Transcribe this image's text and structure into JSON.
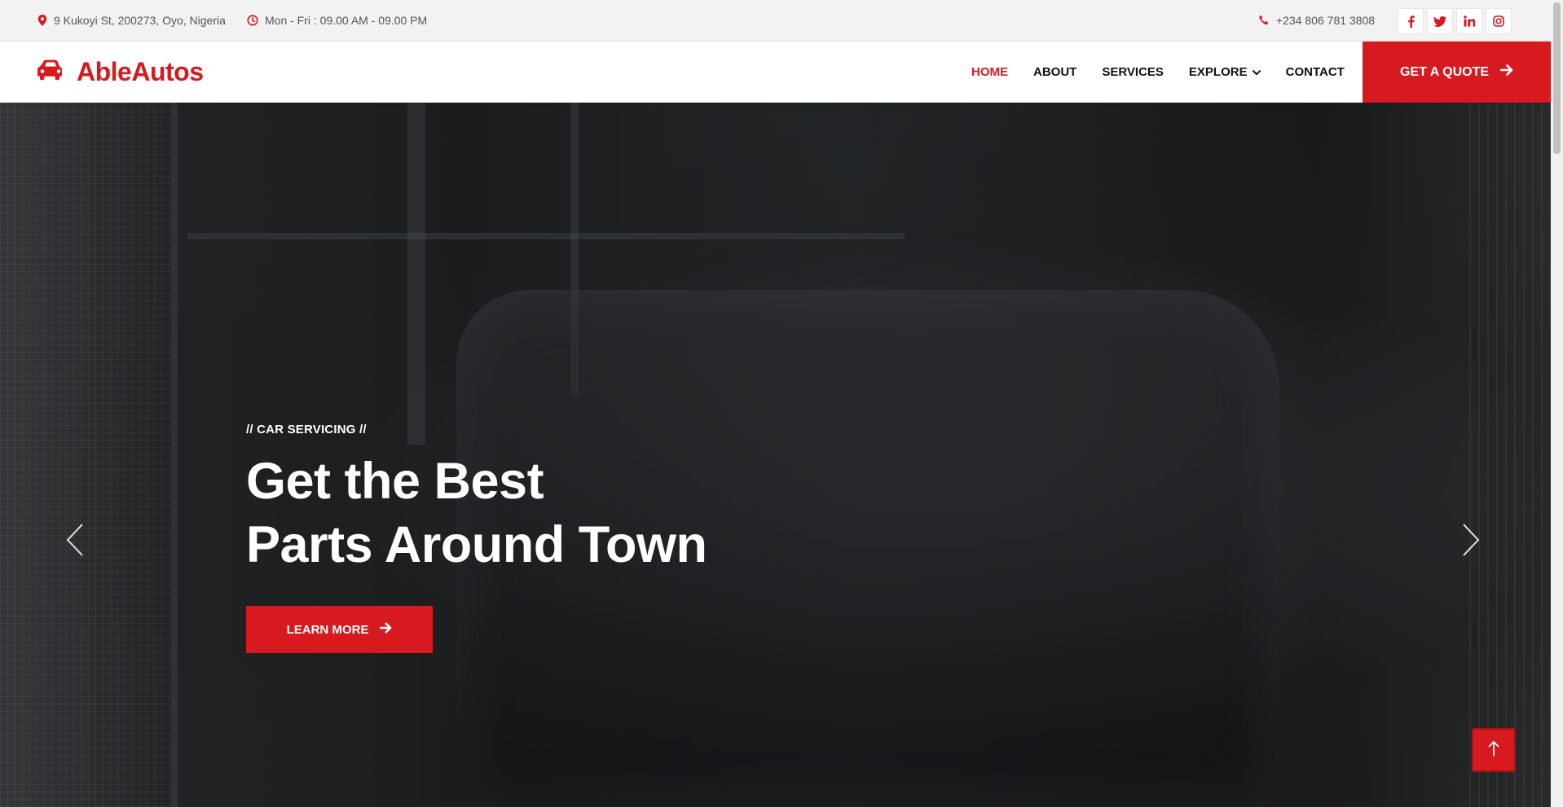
{
  "topbar": {
    "address": "9 Kukoyi St, 200273, Oyo, Nigeria",
    "hours": "Mon - Fri : 09.00 AM - 09.00 PM",
    "phone": "+234 806 781 3808",
    "socials": [
      "facebook-icon",
      "twitter-icon",
      "linkedin-icon",
      "instagram-icon"
    ]
  },
  "brand": {
    "name": "AbleAutos",
    "icon": "car-icon"
  },
  "nav": {
    "items": [
      {
        "label": "HOME",
        "active": true
      },
      {
        "label": "ABOUT"
      },
      {
        "label": "SERVICES"
      },
      {
        "label": "EXPLORE",
        "has_dropdown": true
      },
      {
        "label": "CONTACT"
      }
    ],
    "cta": "GET A QUOTE"
  },
  "hero": {
    "kicker": "// CAR SERVICING //",
    "title_line1": "Get the Best",
    "title_line2": "Parts Around Town",
    "button": "LEARN MORE"
  },
  "colors": {
    "accent": "#d71920",
    "dark": "#111111",
    "topbar_bg": "#f2f2f2"
  }
}
